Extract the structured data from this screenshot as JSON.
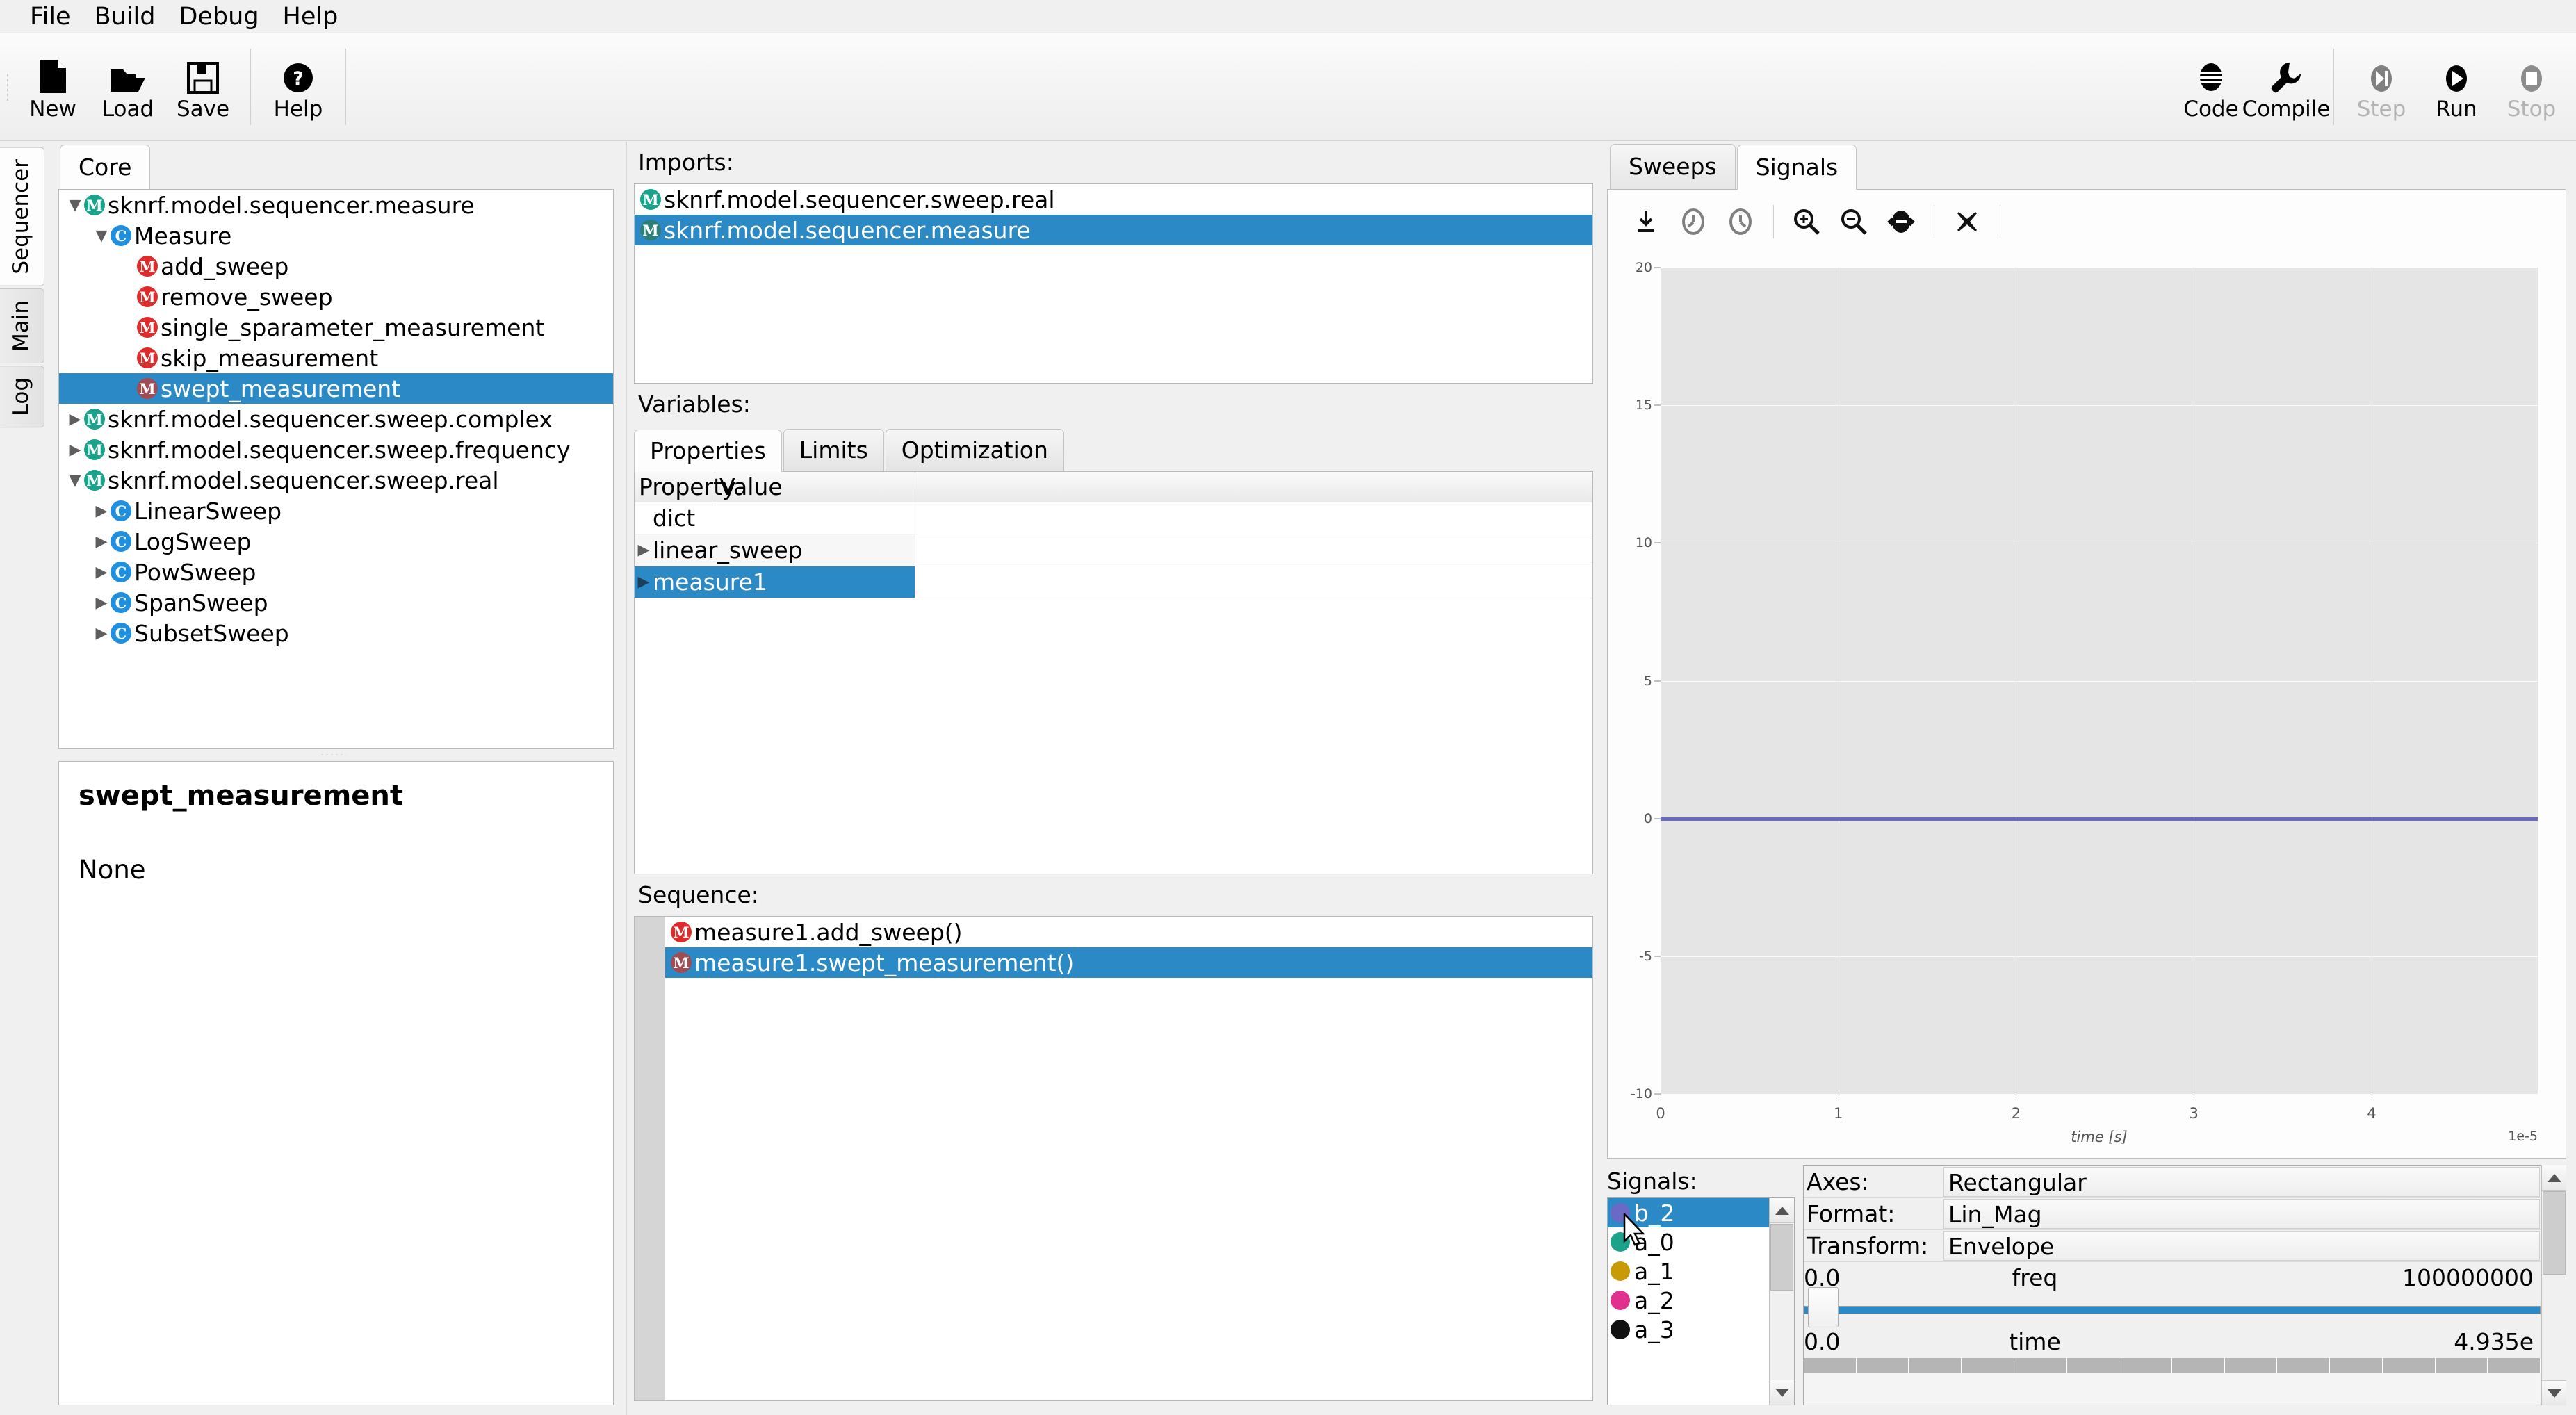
{
  "menubar": {
    "items": [
      "File",
      "Build",
      "Debug",
      "Help"
    ]
  },
  "toolbar": {
    "left": [
      {
        "label": "New",
        "icon": "new-file-icon",
        "disabled": false
      },
      {
        "label": "Load",
        "icon": "open-folder-icon",
        "disabled": false
      },
      {
        "label": "Save",
        "icon": "floppy-disk-icon",
        "disabled": false
      },
      {
        "label": "Help",
        "icon": "question-circle-icon",
        "disabled": false
      }
    ],
    "right": [
      {
        "label": "Code",
        "icon": "code-icon",
        "disabled": false
      },
      {
        "label": "Compile",
        "icon": "wrench-icon",
        "disabled": false
      },
      {
        "label": "Step",
        "icon": "step-icon",
        "disabled": true
      },
      {
        "label": "Run",
        "icon": "play-icon",
        "disabled": false
      },
      {
        "label": "Stop",
        "icon": "stop-icon",
        "disabled": true
      }
    ]
  },
  "vertical_tabs": [
    {
      "label": "Sequencer",
      "active": true
    },
    {
      "label": "Main",
      "active": false
    },
    {
      "label": "Log",
      "active": false
    }
  ],
  "left_panel": {
    "tabs": [
      {
        "label": "Core",
        "active": true
      }
    ],
    "tree": [
      {
        "label": "sknrf.model.sequencer.measure",
        "indent": 0,
        "arrow": "down",
        "badge": "module",
        "selected": false
      },
      {
        "label": "Measure",
        "indent": 1,
        "arrow": "down",
        "badge": "class",
        "selected": false
      },
      {
        "label": "add_sweep",
        "indent": 2,
        "arrow": "none",
        "badge": "method",
        "selected": false
      },
      {
        "label": "remove_sweep",
        "indent": 2,
        "arrow": "none",
        "badge": "method",
        "selected": false
      },
      {
        "label": "single_sparameter_measurement",
        "indent": 2,
        "arrow": "none",
        "badge": "method",
        "selected": false
      },
      {
        "label": "skip_measurement",
        "indent": 2,
        "arrow": "none",
        "badge": "method",
        "selected": false
      },
      {
        "label": "swept_measurement",
        "indent": 2,
        "arrow": "none",
        "badge": "method",
        "selected": true
      },
      {
        "label": "sknrf.model.sequencer.sweep.complex",
        "indent": 0,
        "arrow": "right",
        "badge": "module",
        "selected": false
      },
      {
        "label": "sknrf.model.sequencer.sweep.frequency",
        "indent": 0,
        "arrow": "right",
        "badge": "module",
        "selected": false
      },
      {
        "label": "sknrf.model.sequencer.sweep.real",
        "indent": 0,
        "arrow": "down",
        "badge": "module",
        "selected": false
      },
      {
        "label": "LinearSweep",
        "indent": 1,
        "arrow": "right",
        "badge": "class",
        "selected": false
      },
      {
        "label": "LogSweep",
        "indent": 1,
        "arrow": "right",
        "badge": "class",
        "selected": false
      },
      {
        "label": "PowSweep",
        "indent": 1,
        "arrow": "right",
        "badge": "class",
        "selected": false
      },
      {
        "label": "SpanSweep",
        "indent": 1,
        "arrow": "right",
        "badge": "class",
        "selected": false
      },
      {
        "label": "SubsetSweep",
        "indent": 1,
        "arrow": "right",
        "badge": "class",
        "selected": false
      }
    ],
    "doc": {
      "title": "swept_measurement",
      "body": "None"
    }
  },
  "center_panel": {
    "imports_label": "Imports:",
    "imports": [
      {
        "label": "sknrf.model.sequencer.sweep.real",
        "badge": "module",
        "selected": false
      },
      {
        "label": "sknrf.model.sequencer.measure",
        "badge": "module",
        "selected": true
      }
    ],
    "variables_label": "Variables:",
    "variable_tabs": [
      {
        "label": "Properties",
        "active": true
      },
      {
        "label": "Limits",
        "active": false
      },
      {
        "label": "Optimization",
        "active": false
      }
    ],
    "prop_headers": [
      "Property",
      "Value"
    ],
    "prop_rows": [
      {
        "label": "dict",
        "arrow": "none",
        "value": "",
        "selected": false,
        "alt": false
      },
      {
        "label": "linear_sweep",
        "arrow": "right",
        "value": "",
        "selected": false,
        "alt": true
      },
      {
        "label": "measure1",
        "arrow": "right",
        "value": "",
        "selected": true,
        "alt": false
      }
    ],
    "sequence_label": "Sequence:",
    "sequence": [
      {
        "label": "measure1.add_sweep()",
        "badge": "method",
        "selected": false
      },
      {
        "label": "measure1.swept_measurement()",
        "badge": "method",
        "selected": true
      }
    ]
  },
  "right_panel": {
    "tabs": [
      {
        "label": "Sweeps",
        "active": false
      },
      {
        "label": "Signals",
        "active": true
      }
    ],
    "plot_toolbar": [
      {
        "icon": "download-icon",
        "name": "save-plot-button"
      },
      {
        "icon": "undo-icon",
        "name": "undo-button"
      },
      {
        "icon": "redo-icon",
        "name": "redo-button"
      },
      {
        "icon": "zoom-in-icon",
        "name": "zoom-in-button"
      },
      {
        "icon": "zoom-out-icon",
        "name": "zoom-out-button"
      },
      {
        "icon": "fit-width-icon",
        "name": "autoscale-button"
      },
      {
        "icon": "clear-icon",
        "name": "clear-button"
      }
    ],
    "signals_label": "Signals:",
    "signals": [
      {
        "label": "b_2",
        "color": "#6a6ac4",
        "selected": true
      },
      {
        "label": "a_0",
        "color": "#1aa38a",
        "selected": false
      },
      {
        "label": "a_1",
        "color": "#c99a07",
        "selected": false
      },
      {
        "label": "a_2",
        "color": "#e0318f",
        "selected": false
      },
      {
        "label": "a_3",
        "color": "#111111",
        "selected": false
      }
    ],
    "settings": [
      {
        "key": "Axes:",
        "value": "Rectangular"
      },
      {
        "key": "Format:",
        "value": "Lin_Mag"
      },
      {
        "key": "Transform:",
        "value": "Envelope"
      }
    ],
    "sliders": [
      {
        "min": "0.0",
        "name": "freq",
        "value": "100000000"
      },
      {
        "min": "0.0",
        "name": "time",
        "value": "4.935e"
      }
    ]
  },
  "chart_data": {
    "type": "line",
    "title": "",
    "xlabel": "time [s]",
    "ylabel": "",
    "x_exponent": "1e-5",
    "xticks": [
      0,
      1,
      2,
      3,
      4
    ],
    "yticks": [
      -10,
      -5,
      0,
      5,
      10,
      15,
      20
    ],
    "xlim": [
      0,
      4.935
    ],
    "ylim": [
      -10,
      20
    ],
    "grid": true,
    "series": [
      {
        "name": "b_2",
        "color": "#6a6ac4",
        "constant_y": 0
      }
    ]
  }
}
